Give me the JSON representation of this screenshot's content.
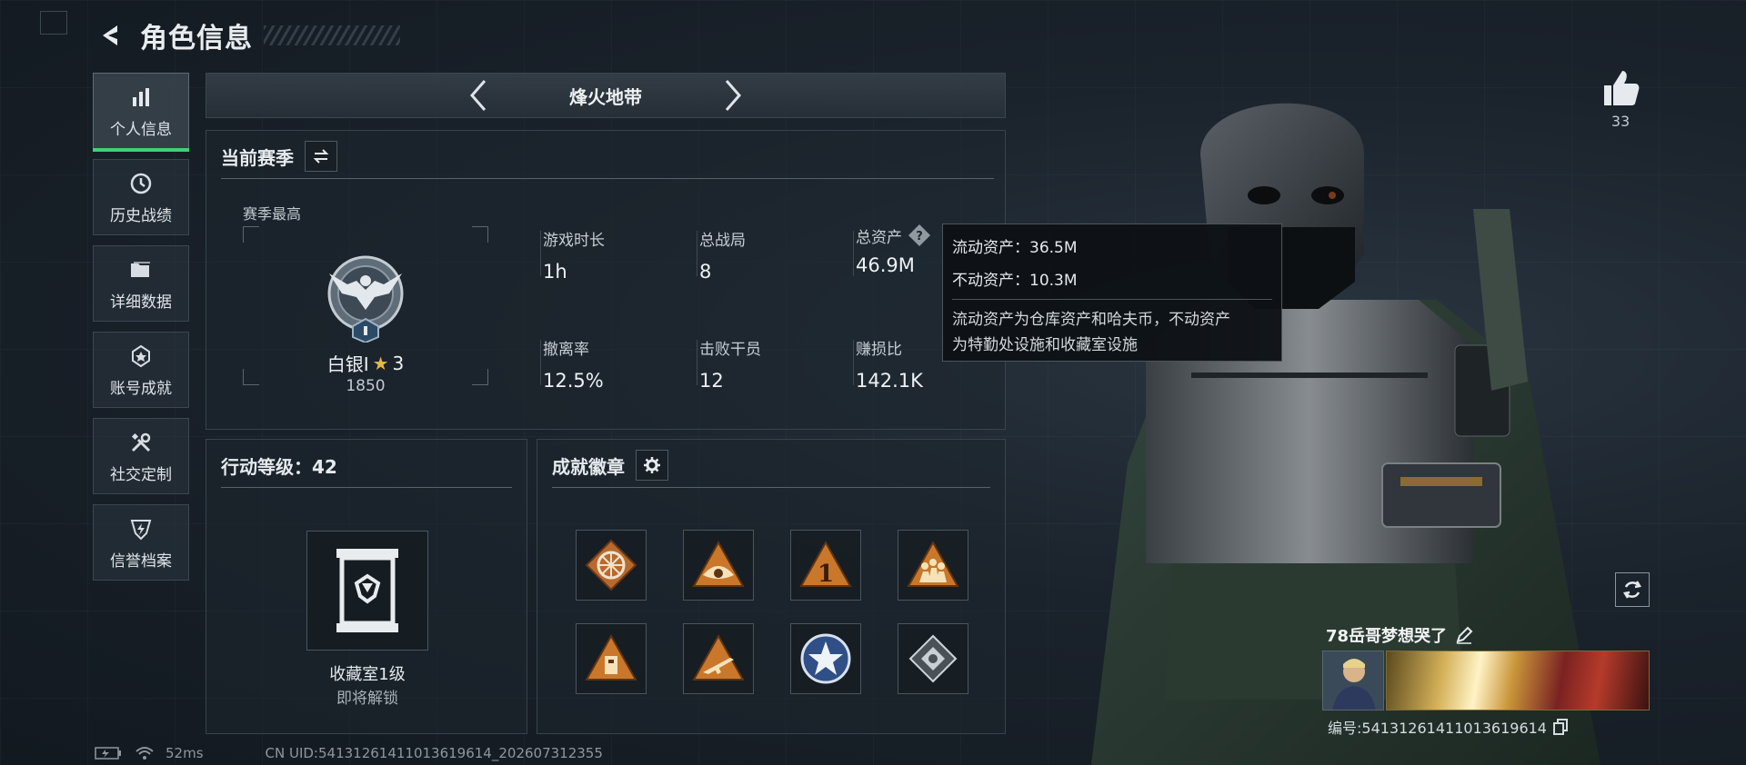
{
  "header": {
    "title": "角色信息"
  },
  "sidenav": {
    "items": [
      {
        "label": "个人信息",
        "icon": "bar-chart-icon"
      },
      {
        "label": "历史战绩",
        "icon": "history-clock-icon"
      },
      {
        "label": "详细数据",
        "icon": "folder-icon"
      },
      {
        "label": "账号成就",
        "icon": "achievement-icon"
      },
      {
        "label": "社交定制",
        "icon": "tools-icon"
      },
      {
        "label": "信誉档案",
        "icon": "shield-bolt-icon"
      }
    ]
  },
  "mode_tab": {
    "title": "烽火地带"
  },
  "season": {
    "title": "当前赛季",
    "subtitle": "赛季最高",
    "rank_name": "白银I",
    "rank_stars": "3",
    "rank_points": "1850",
    "stats": [
      {
        "label": "游戏时长",
        "value": "1h"
      },
      {
        "label": "总战局",
        "value": "8"
      },
      {
        "label": "总资产",
        "value": "46.9M"
      },
      {
        "label": "撤离率",
        "value": "12.5%"
      },
      {
        "label": "击败干员",
        "value": "12"
      },
      {
        "label": "赚损比",
        "value": "142.1K"
      }
    ]
  },
  "tooltip": {
    "liquid": "流动资产：36.5M",
    "fixed": "不动资产：10.3M",
    "desc_line1": "流动资产为仓库资产和哈夫币，不动资产",
    "desc_line2": "为特勤处设施和收藏室设施"
  },
  "action_level": {
    "title": "行动等级：42",
    "collection_name": "收藏室1级",
    "collection_status": "即将解锁"
  },
  "badges": {
    "title": "成就徽章",
    "items": [
      "wheel-badge-icon",
      "eye-badge-icon",
      "number-one-badge-icon",
      "team-badge-icon",
      "locker-badge-icon",
      "rifle-badge-icon",
      "star-emblem-badge-icon",
      "diamond-badge-icon"
    ]
  },
  "player": {
    "likes": "33",
    "name": "78岳哥梦想哭了",
    "id": "编号:54131261411013619614"
  },
  "footer": {
    "ping": "52ms",
    "uid": "CN UID:54131261411013619614_202607312355"
  },
  "colors": {
    "accent": "#3fd07a",
    "rank_star": "#e3b845",
    "badge_orange": "#c9772a"
  }
}
